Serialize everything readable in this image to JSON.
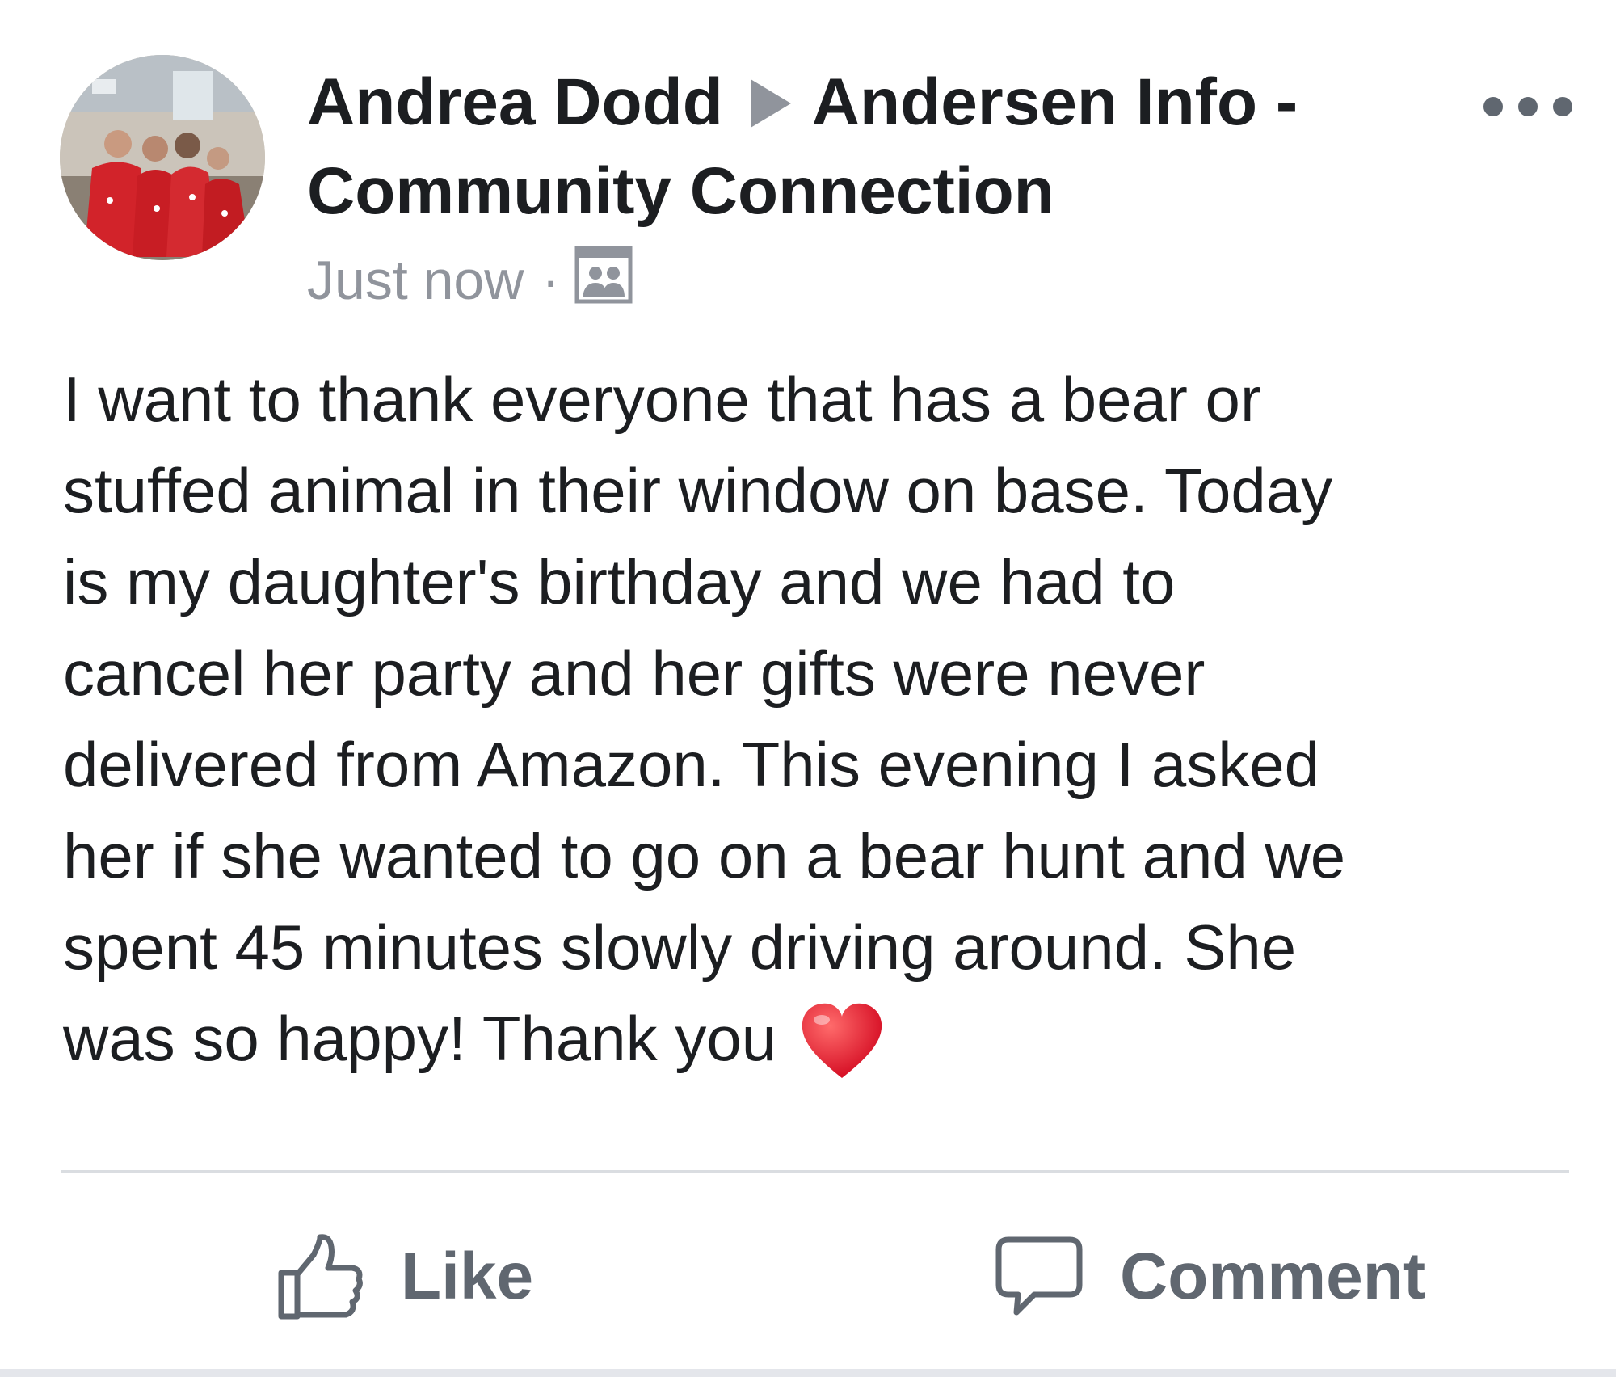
{
  "post": {
    "author": "Andrea Dodd",
    "group": "Andersen Info - Community Connection",
    "timestamp": "Just now",
    "separator": "·",
    "audience_icon": "group-members-icon",
    "more_icon": "more-options-icon",
    "text": "I want to thank everyone that has a bear or\nstuffed animal in their window on base. Today\nis my daughter's birthday and we had to\ncancel her party and her gifts were never\ndelivered from Amazon.  This evening I asked\nher if she wanted to go on a bear hunt and we\nspent 45 minutes slowly driving around.  She\nwas so happy! Thank you",
    "emoji": "red-heart-emoji"
  },
  "actions": {
    "like_label": "Like",
    "comment_label": "Comment"
  },
  "colors": {
    "text": "#1c1e21",
    "muted": "#90949c",
    "action": "#606770",
    "divider": "#dadde1",
    "heart": "#e0102c"
  }
}
